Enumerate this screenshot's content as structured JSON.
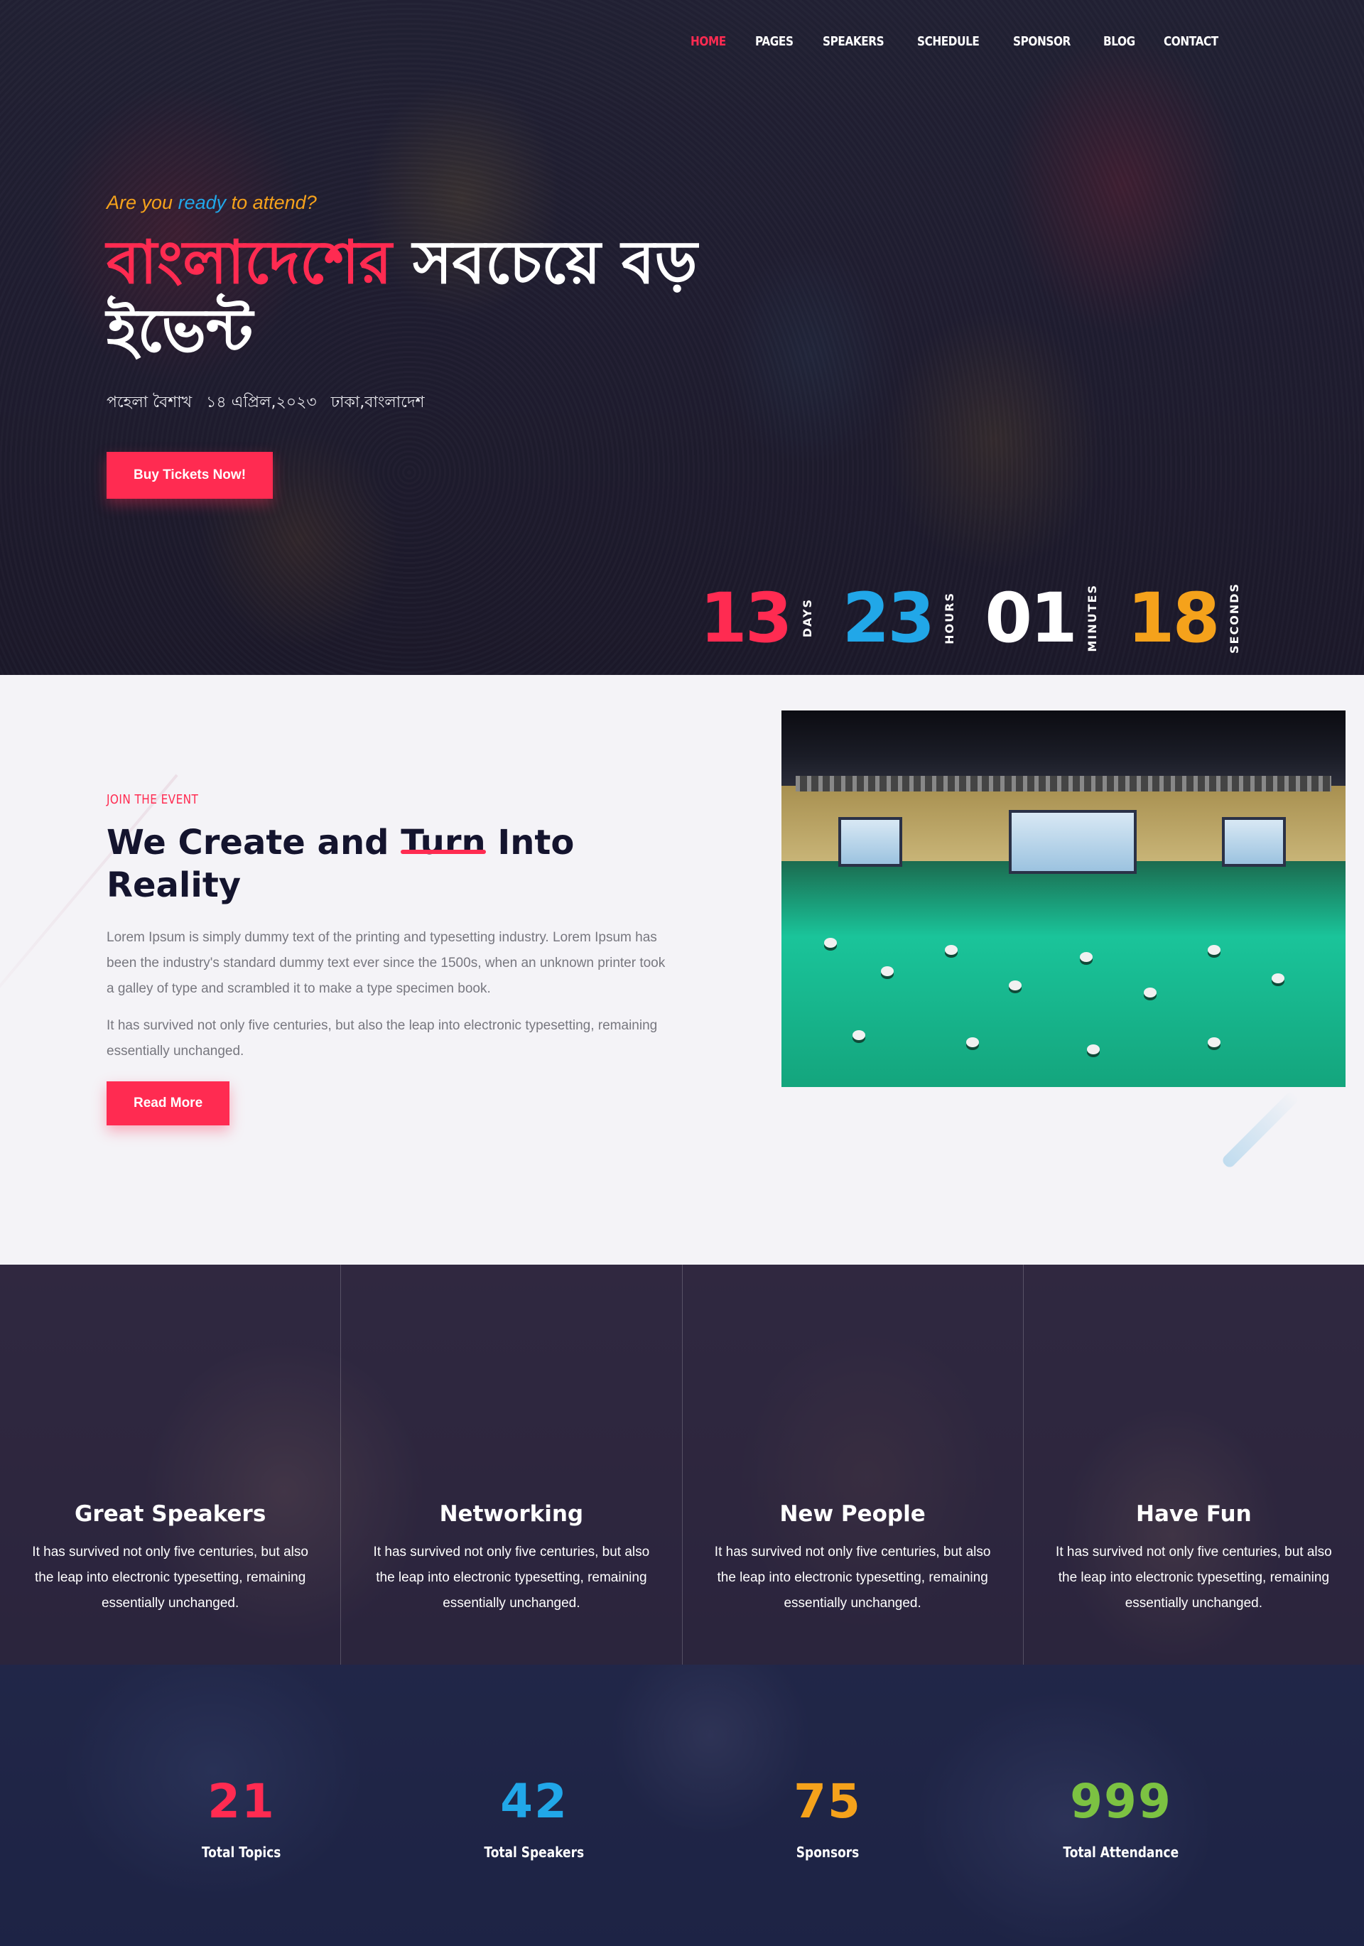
{
  "nav": {
    "items": [
      {
        "label": "HOME",
        "active": true
      },
      {
        "label": "PAGES"
      },
      {
        "label": "SPEAKERS"
      },
      {
        "label": "SCHEDULE"
      },
      {
        "label": "SPONSOR"
      },
      {
        "label": "BLOG"
      },
      {
        "label": "CONTACT"
      }
    ]
  },
  "hero": {
    "tagline_pre": "Are you ",
    "tagline_hl": "ready",
    "tagline_post": " to attend?",
    "title_red": "বাংলাদেশের",
    "title_white": " সবচেয়ে বড় ইভেন্ট",
    "meta": [
      "পহেলা বৈশাখ",
      "১৪ এপ্রিল,২০২৩",
      "ঢাকা,বাংলাদেশ"
    ],
    "button": "Buy Tickets Now!"
  },
  "countdown": [
    {
      "value": "13",
      "label": "DAYS",
      "color": "#ff2b51"
    },
    {
      "value": "23",
      "label": "HOURS",
      "color": "#21a7e8"
    },
    {
      "value": "01",
      "label": "MINUTES",
      "color": "#ffffff"
    },
    {
      "value": "18",
      "label": "SECONDS",
      "color": "#f5a21b"
    }
  ],
  "about": {
    "kicker": "JOIN THE EVENT",
    "title_pre": "We Create and ",
    "title_ul": "Turn",
    "title_post": " Into Reality",
    "para1": "Lorem Ipsum is simply dummy text of the printing and typesetting industry. Lorem Ipsum has been the industry's standard dummy text ever since the 1500s, when an unknown printer took a galley of type and scrambled it to make a type specimen book.",
    "para2": "It has survived not only five centuries, but also the leap into electronic typesetting, remaining essentially unchanged.",
    "button": "Read More"
  },
  "features": [
    {
      "title": "Great Speakers",
      "text": "It has survived not only five centuries, but also the leap into electronic typesetting, remaining essentially unchanged."
    },
    {
      "title": "Networking",
      "text": "It has survived not only five centuries, but also the leap into electronic typesetting, remaining essentially unchanged."
    },
    {
      "title": "New People",
      "text": "It has survived not only five centuries, but also the leap into electronic typesetting, remaining essentially unchanged."
    },
    {
      "title": "Have Fun",
      "text": "It has survived not only five centuries, but also the leap into electronic typesetting, remaining essentially unchanged."
    }
  ],
  "stats": [
    {
      "value": "21",
      "label": "Total Topics",
      "color": "#ff2b51"
    },
    {
      "value": "42",
      "label": "Total Speakers",
      "color": "#21a7e8"
    },
    {
      "value": "75",
      "label": "Sponsors",
      "color": "#f5a21b"
    },
    {
      "value": "999",
      "label": "Total Attendance",
      "color": "#7cc242"
    }
  ],
  "colors": {
    "accent": "#ff2b51",
    "blue": "#21a7e8",
    "orange": "#f5a21b",
    "green": "#7cc242"
  }
}
